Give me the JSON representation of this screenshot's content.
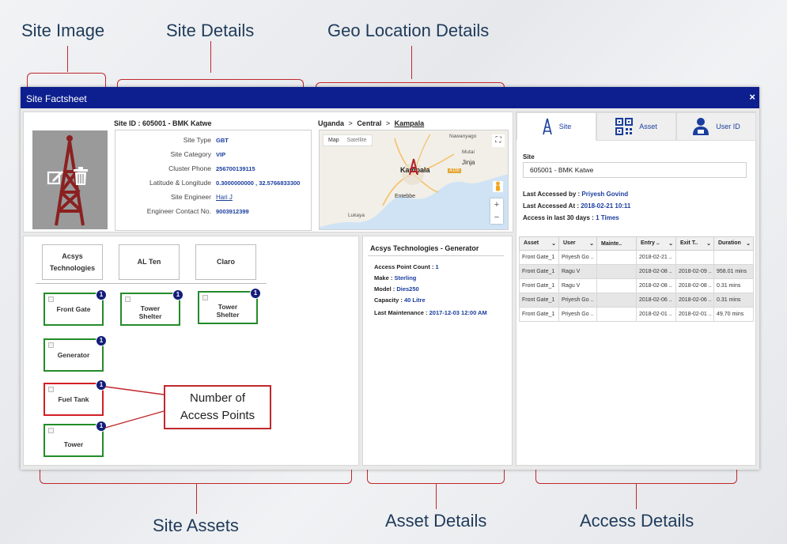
{
  "annotations": {
    "site_image": "Site Image",
    "site_details": "Site Details",
    "geo_location": "Geo Location Details",
    "site_assets": "Site Assets",
    "asset_details": "Asset Details",
    "access_details": "Access Details",
    "callout_line1": "Number of",
    "callout_line2": "Access Points"
  },
  "dialog": {
    "title": "Site Factsheet",
    "close": "×"
  },
  "site": {
    "id_label": "Site ID : 605001 - BMK Katwe",
    "details": [
      {
        "label": "Site Type",
        "value": "GBT"
      },
      {
        "label": "Site Category",
        "value": "VIP"
      },
      {
        "label": "Cluster Phone",
        "value": "256700139115"
      },
      {
        "label": "Latitude & Longitude",
        "value": "0.3000000000 , 32.5766833300"
      },
      {
        "label": "Site Engineer",
        "value": "Hari J"
      },
      {
        "label": "Engineer Contact No.",
        "value": "9003912399"
      }
    ]
  },
  "geo": {
    "crumbs": [
      "Uganda",
      "Central",
      "Kampala"
    ],
    "sep": ">",
    "map_btn": "Map",
    "satellite_btn": "Satellite",
    "places": [
      "Nawanyago",
      "Mutai",
      "Jinja",
      "Kampala",
      "Entebbe",
      "Lukaya"
    ],
    "road": "A109",
    "zoom_in": "+",
    "zoom_out": "−",
    "fullscreen": "⛶"
  },
  "vendors": [
    {
      "line1": "Acsys",
      "line2": "Technologies"
    },
    {
      "line1": "AL Ten",
      "line2": ""
    },
    {
      "line1": "Claro",
      "line2": ""
    }
  ],
  "assets": [
    {
      "line1": "Front Gate",
      "line2": "",
      "count": "1",
      "status": "green"
    },
    {
      "line1": "Tower",
      "line2": "Shelter",
      "count": "1",
      "status": "green"
    },
    {
      "line1": "Tower",
      "line2": "Shelter",
      "count": "1",
      "status": "green"
    },
    {
      "line1": "Generator",
      "line2": "",
      "count": "1",
      "status": "green"
    },
    {
      "line1": "Fuel Tank",
      "line2": "",
      "count": "1",
      "status": "red"
    },
    {
      "line1": "Tower",
      "line2": "",
      "count": "1",
      "status": "green"
    }
  ],
  "asset_details": {
    "title": "Acsys Technologies - Generator",
    "rows": [
      {
        "label": "Access Point Count : ",
        "value": "1"
      },
      {
        "label": "Make : ",
        "value": "Sterling"
      },
      {
        "label": "Model : ",
        "value": "Dies250"
      },
      {
        "label": "Capacity : ",
        "value": "40 Litre"
      },
      {
        "label": "Last Maintenance : ",
        "value": "2017-12-03 12:00 AM"
      }
    ]
  },
  "access": {
    "tabs": [
      "Site",
      "Asset",
      "User ID"
    ],
    "site_label": "Site",
    "site_value": "605001 - BMK Katwe",
    "last_by_label": "Last Accessed by : ",
    "last_by": "Priyesh Govind",
    "last_at_label": "Last Accessed At : ",
    "last_at": "2018-02-21 10:11",
    "last30_label": "Access in last 30 days : ",
    "last30": "1 Times",
    "columns": [
      "Asset",
      "User",
      "Mainte..",
      "Entry ..",
      "Exit T..",
      "Duration"
    ],
    "rows": [
      [
        "Front Gate_1",
        "Priyesh Go ..",
        "",
        "2018-02-21 ..",
        "",
        ""
      ],
      [
        "Front Gate_1",
        "Ragu V",
        "",
        "2018-02-08 ..",
        "2018-02-09 ..",
        "958.01 mins"
      ],
      [
        "Front Gate_1",
        "Ragu V",
        "",
        "2018-02-08 ..",
        "2018-02-08 ..",
        "0.31 mins"
      ],
      [
        "Front Gate_1",
        "Priyesh Go ..",
        "",
        "2018-02-06 ..",
        "2018-02-06 ..",
        "0.31 mins"
      ],
      [
        "Front Gate_1",
        "Priyesh Go ..",
        "",
        "2018-02-01 ..",
        "2018-02-01 ..",
        "49.70 mins"
      ]
    ]
  },
  "colors": {
    "titlebar": "#0d1f8f",
    "link": "#1a3e9e",
    "annotation": "#c0282d",
    "asset_ok": "#238c2a",
    "asset_alert": "#d21f26",
    "badge": "#141e7a"
  }
}
